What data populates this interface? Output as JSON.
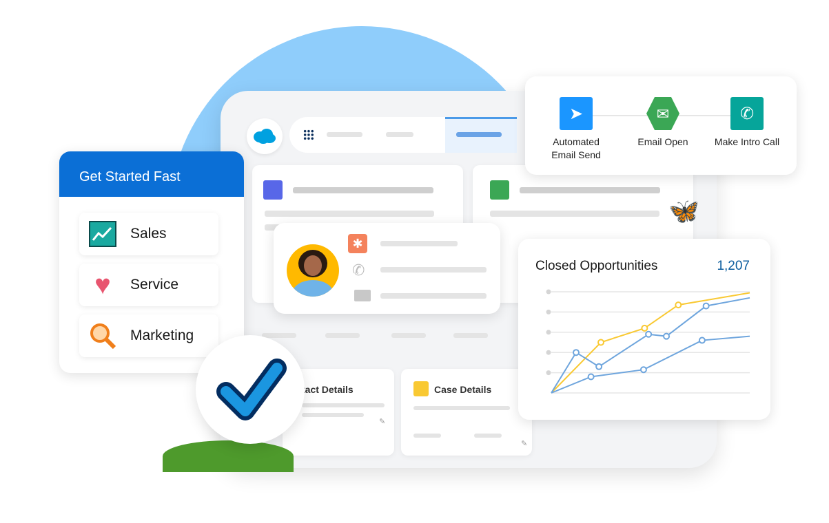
{
  "get_started": {
    "title": "Get Started Fast",
    "items": [
      {
        "label": "Sales",
        "icon": "sales-chart-icon"
      },
      {
        "label": "Service",
        "icon": "heart-icon"
      },
      {
        "label": "Marketing",
        "icon": "magnifier-person-icon"
      }
    ]
  },
  "flow": {
    "steps": [
      {
        "label": "Automated Email Send",
        "icon": "send-icon",
        "color": "#1b96ff"
      },
      {
        "label": "Email Open",
        "icon": "email-open-icon",
        "color": "#3ba755"
      },
      {
        "label": "Make Intro Call",
        "icon": "phone-icon",
        "color": "#06a59a"
      }
    ]
  },
  "cards": {
    "contact_details": "tact Details",
    "case_details": "Case Details"
  },
  "colors": {
    "brand": "#0b6fd6",
    "yellow": "#f9c933",
    "blue_line": "#6ea5dd",
    "value": "#0b5c9e"
  },
  "chart_data": {
    "type": "line",
    "title": "Closed Opportunities",
    "total": "1,207",
    "ylim": [
      0,
      5
    ],
    "xlim": [
      0,
      100
    ],
    "grid": true,
    "series": [
      {
        "color": "#f9c933",
        "x": [
          0,
          25,
          47,
          64,
          100
        ],
        "y": [
          0,
          2.5,
          3.2,
          4.35,
          4.95
        ]
      },
      {
        "color": "#6ea5dd",
        "x": [
          0,
          12.5,
          24,
          49,
          58,
          78,
          100
        ],
        "y": [
          0,
          2.0,
          1.3,
          2.9,
          2.8,
          4.3,
          4.7
        ]
      },
      {
        "color": "#6ea5dd",
        "x": [
          0,
          20,
          46.5,
          76,
          100
        ],
        "y": [
          0,
          0.8,
          1.15,
          2.6,
          2.8
        ]
      }
    ]
  }
}
